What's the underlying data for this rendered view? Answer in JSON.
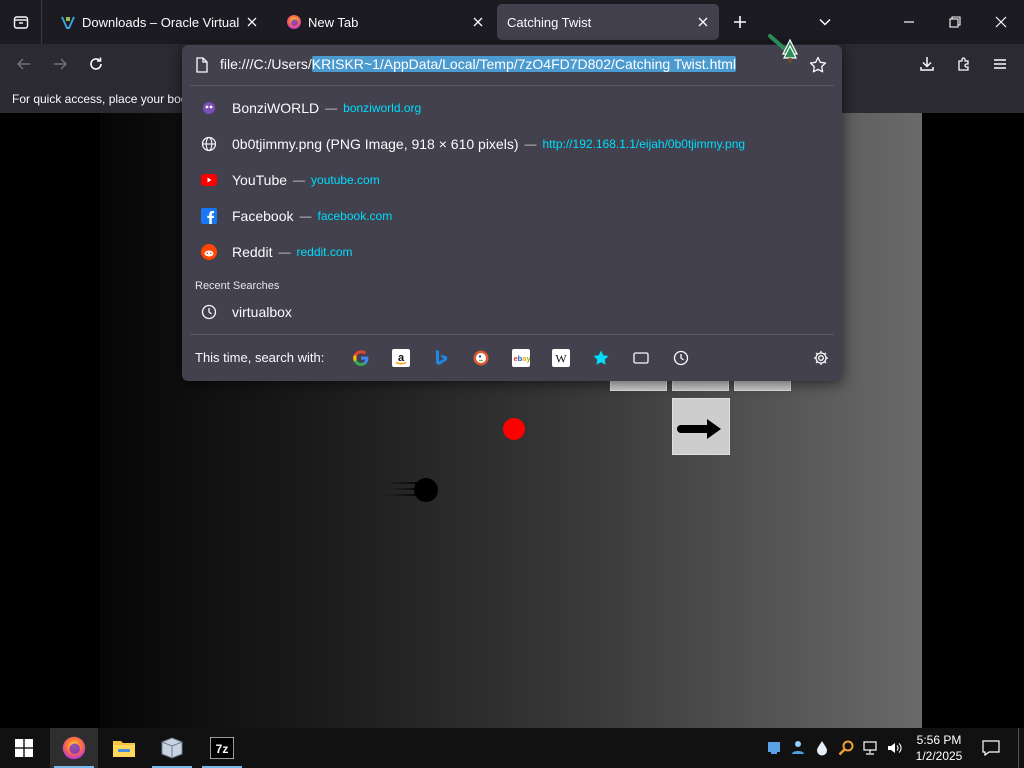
{
  "tabs": [
    {
      "title": "Downloads – Oracle VirtualBox",
      "favicon": "virtualbox-favicon-icon",
      "active": false
    },
    {
      "title": "New Tab",
      "favicon": "firefox-favicon-icon",
      "active": false
    },
    {
      "title": "Catching Twist",
      "favicon": "",
      "active": true
    }
  ],
  "bookmarks_bar": {
    "text": "For quick access, place your boo"
  },
  "urlbar": {
    "prefix": "file:///C:/Users/",
    "selected": "KRISKR~1/AppData/Local/Temp/7zO4FD7D802/Catching Twist.html"
  },
  "suggestions": [
    {
      "title": "BonziWORLD",
      "separator": "—",
      "url": "bonziworld.org",
      "icon": "bonziworld-favicon-icon"
    },
    {
      "title": "0b0tjimmy.png (PNG Image, 918 × 610 pixels)",
      "separator": "—",
      "url": "http://192.168.1.1/eijah/0b0tjimmy.png",
      "icon": "globe-icon"
    },
    {
      "title": "YouTube",
      "separator": "—",
      "url": "youtube.com",
      "icon": "youtube-icon"
    },
    {
      "title": "Facebook",
      "separator": "—",
      "url": "facebook.com",
      "icon": "facebook-icon"
    },
    {
      "title": "Reddit",
      "separator": "—",
      "url": "reddit.com",
      "icon": "reddit-icon"
    }
  ],
  "recent_searches": {
    "header": "Recent Searches",
    "items": [
      {
        "text": "virtualbox",
        "icon": "history-clock-icon"
      }
    ]
  },
  "search_with": {
    "label": "This time, search with:",
    "engines": [
      "google-icon",
      "amazon-icon",
      "bing-icon",
      "duckduckgo-icon",
      "ebay-icon",
      "wikipedia-icon",
      "bookmarks-star-icon",
      "tabs-icon",
      "history-icon"
    ]
  },
  "clock": {
    "time": "5:56 PM",
    "date": "1/2/2025"
  },
  "colors": {
    "accent_cyan": "#00ddff",
    "selection": "#4b9bd0",
    "panel": "#42414d",
    "red_dot": "#ff0000"
  }
}
